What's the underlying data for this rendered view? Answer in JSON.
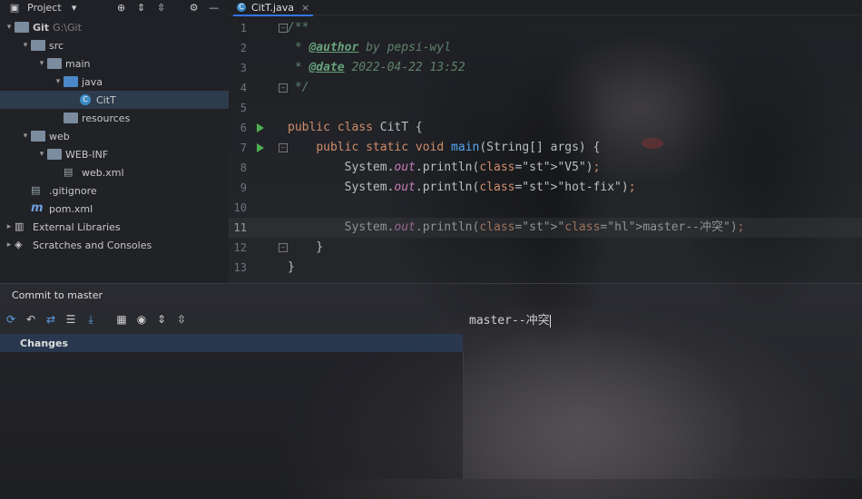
{
  "project_panel": {
    "title": "Project",
    "tree": [
      {
        "label": "Git",
        "path": "G:\\Git",
        "depth": 0,
        "expanded": true,
        "icon": "folder-icon"
      },
      {
        "label": "src",
        "depth": 1,
        "expanded": true,
        "icon": "folder-icon"
      },
      {
        "label": "main",
        "depth": 2,
        "expanded": true,
        "icon": "folder-icon"
      },
      {
        "label": "java",
        "depth": 3,
        "expanded": true,
        "icon": "source-folder-icon"
      },
      {
        "label": "CitT",
        "depth": 4,
        "selected": true,
        "icon": "java-class-icon"
      },
      {
        "label": "resources",
        "depth": 3,
        "icon": "resources-folder-icon"
      },
      {
        "label": "web",
        "depth": 1,
        "expanded": true,
        "icon": "web-folder-icon"
      },
      {
        "label": "WEB-INF",
        "depth": 2,
        "expanded": true,
        "icon": "folder-icon"
      },
      {
        "label": "web.xml",
        "depth": 3,
        "icon": "xml-file-icon"
      },
      {
        "label": ".gitignore",
        "depth": 1,
        "icon": "gitignore-file-icon"
      },
      {
        "label": "pom.xml",
        "depth": 1,
        "icon": "maven-file-icon"
      },
      {
        "label": "External Libraries",
        "depth": 0,
        "icon": "libraries-icon"
      },
      {
        "label": "Scratches and Consoles",
        "depth": 0,
        "icon": "scratches-icon"
      }
    ]
  },
  "editor": {
    "tab_label": "CitT.java",
    "current_line": 11,
    "lines": [
      {
        "n": "1",
        "text": "/**"
      },
      {
        "n": "2",
        "text": " * @author by pepsi-wyl"
      },
      {
        "n": "3",
        "text": " * @date 2022-04-22 13:52"
      },
      {
        "n": "4",
        "text": " */"
      },
      {
        "n": "5",
        "text": ""
      },
      {
        "n": "6",
        "text": "public class CitT {"
      },
      {
        "n": "7",
        "text": "    public static void main(String[] args) {"
      },
      {
        "n": "8",
        "text": "        System.out.println(\"V5\");"
      },
      {
        "n": "9",
        "text": "        System.out.println(\"hot-fix\");"
      },
      {
        "n": "10",
        "text": ""
      },
      {
        "n": "11",
        "text": "        System.out.println(\"master--冲突\");"
      },
      {
        "n": "12",
        "text": "    }"
      },
      {
        "n": "13",
        "text": "}"
      }
    ]
  },
  "commit": {
    "title": "Commit to master",
    "changes_label": "Changes",
    "message": "master--冲突"
  },
  "colors": {
    "keyword": "#cf8e6d",
    "string": "#6aab73",
    "comment": "#5f826b",
    "selection": "#2d3b4d",
    "accent": "#3574f0"
  }
}
